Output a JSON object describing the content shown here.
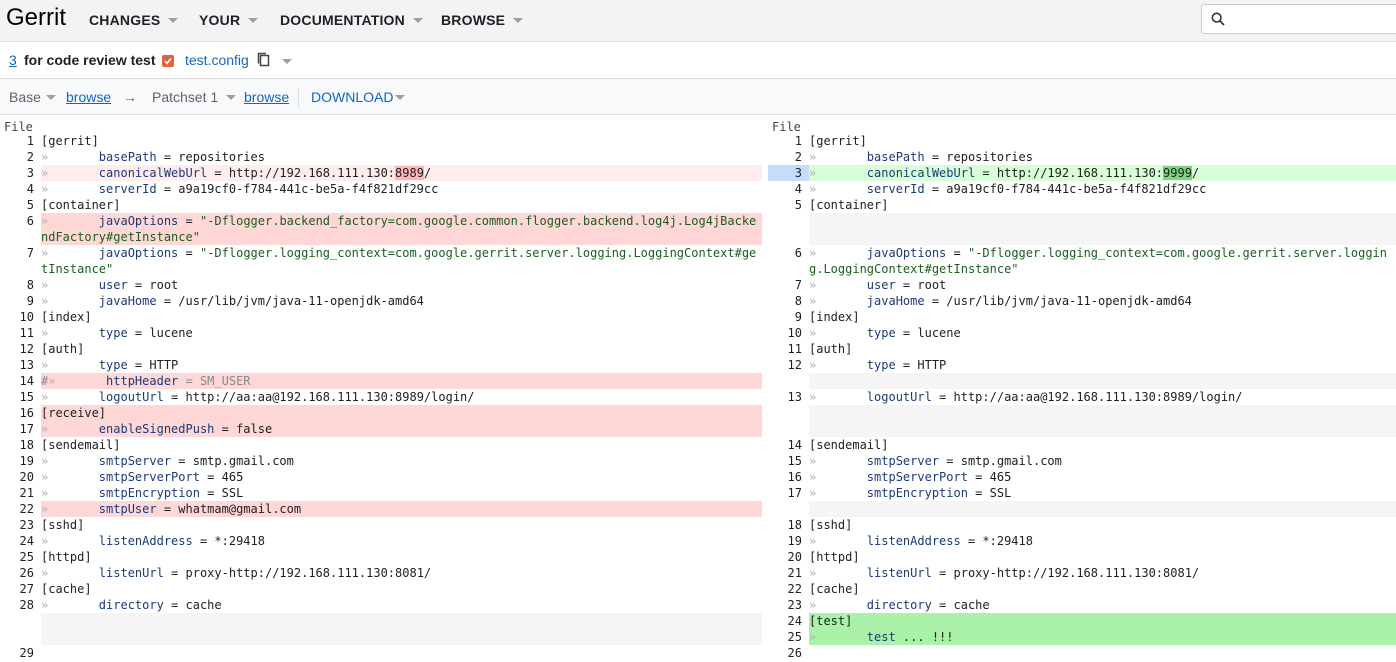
{
  "header": {
    "logo": "Gerrit",
    "nav": [
      {
        "label": "CHANGES"
      },
      {
        "label": "YOUR"
      },
      {
        "label": "DOCUMENTATION"
      },
      {
        "label": "BROWSE"
      }
    ],
    "search_placeholder": ""
  },
  "change": {
    "number": "3",
    "subject": "for code review test",
    "file": "test.config"
  },
  "patchset_bar": {
    "base_label": "Base",
    "browse1": "browse",
    "arrow": "→",
    "patchset_label": "Patchset 1",
    "browse2": "browse",
    "download": "DOWNLOAD"
  },
  "diff": {
    "file_header": "File",
    "left_rows": [
      {
        "ln": "1",
        "type": "same",
        "text": "[gerrit]"
      },
      {
        "ln": "2",
        "type": "same",
        "tab": true,
        "key": "basePath",
        "rest": " = repositories"
      },
      {
        "ln": "3",
        "type": "delb",
        "tab": true,
        "key": "canonicalWebUrl",
        "rest": " = http://192.168.111.130:",
        "hl": "8989",
        "after": "/"
      },
      {
        "ln": "4",
        "type": "same",
        "tab": true,
        "key": "serverId",
        "rest": " = a9a19cf0-f784-441c-be5a-f4f821df29cc"
      },
      {
        "ln": "5",
        "type": "same",
        "text": "[container]"
      },
      {
        "ln": "6",
        "type": "del",
        "tab": true,
        "key": "javaOptions",
        "rest": " = ",
        "str": "\"-Dflogger.backend_factory=com.google.common.flogger.backend.log4j.Log4jBackendFactory#getInstance\""
      },
      {
        "ln": "7",
        "type": "same",
        "tab": true,
        "key": "javaOptions",
        "rest": " = ",
        "str": "\"-Dflogger.logging_context=com.google.gerrit.server.logging.LoggingContext#getInstance\""
      },
      {
        "ln": "8",
        "type": "same",
        "tab": true,
        "key": "user",
        "rest": " = root"
      },
      {
        "ln": "9",
        "type": "same",
        "tab": true,
        "key": "javaHome",
        "rest": " = /usr/lib/jvm/java-11-openjdk-amd64"
      },
      {
        "ln": "10",
        "type": "same",
        "text": "[index]"
      },
      {
        "ln": "11",
        "type": "same",
        "tab": true,
        "key": "type",
        "rest": " = lucene"
      },
      {
        "ln": "12",
        "type": "same",
        "text": "[auth]"
      },
      {
        "ln": "13",
        "type": "same",
        "tab": true,
        "key": "type",
        "rest": " = HTTP"
      },
      {
        "ln": "14",
        "type": "del cmt",
        "hash": true,
        "tab": true,
        "key": "httpHeader",
        "rest": " = SM_USER"
      },
      {
        "ln": "15",
        "type": "same",
        "tab": true,
        "key": "logoutUrl",
        "rest": " = http://aa:aa@192.168.111.130:8989/login/"
      },
      {
        "ln": "16",
        "type": "del",
        "text": "[receive]"
      },
      {
        "ln": "17",
        "type": "del",
        "tab": true,
        "key": "enableSignedPush",
        "rest": " = false"
      },
      {
        "ln": "18",
        "type": "same",
        "text": "[sendemail]"
      },
      {
        "ln": "19",
        "type": "same",
        "tab": true,
        "key": "smtpServer",
        "rest": " = smtp.gmail.com"
      },
      {
        "ln": "20",
        "type": "same",
        "tab": true,
        "key": "smtpServerPort",
        "rest": " = 465"
      },
      {
        "ln": "21",
        "type": "same",
        "tab": true,
        "key": "smtpEncryption",
        "rest": " = SSL"
      },
      {
        "ln": "22",
        "type": "del",
        "tab": true,
        "key": "smtpUser",
        "rest": " = whatmam@gmail.com"
      },
      {
        "ln": "23",
        "type": "same",
        "text": "[sshd]"
      },
      {
        "ln": "24",
        "type": "same",
        "tab": true,
        "key": "listenAddress",
        "rest": " = *:29418"
      },
      {
        "ln": "25",
        "type": "same",
        "text": "[httpd]"
      },
      {
        "ln": "26",
        "type": "same",
        "tab": true,
        "key": "listenUrl",
        "rest": " = proxy-http://192.168.111.130:8081/"
      },
      {
        "ln": "27",
        "type": "same",
        "text": "[cache]"
      },
      {
        "ln": "28",
        "type": "same",
        "tab": true,
        "key": "directory",
        "rest": " = cache"
      },
      {
        "ln": "",
        "type": "empty",
        "text": ""
      },
      {
        "ln": "",
        "type": "empty",
        "text": ""
      },
      {
        "ln": "29",
        "type": "same",
        "text": ""
      }
    ],
    "right_rows": [
      {
        "ln": "1",
        "type": "same",
        "text": "[gerrit]"
      },
      {
        "ln": "2",
        "type": "same",
        "tab": true,
        "key": "basePath",
        "rest": " = repositories"
      },
      {
        "ln": "3",
        "type": "insb",
        "tab": true,
        "key": "canonicalWebUrl",
        "rest": " = http://192.168.111.130:",
        "hl": "9999",
        "after": "/"
      },
      {
        "ln": "4",
        "type": "same",
        "tab": true,
        "key": "serverId",
        "rest": " = a9a19cf0-f784-441c-be5a-f4f821df29cc"
      },
      {
        "ln": "5",
        "type": "same",
        "text": "[container]"
      },
      {
        "ln": "",
        "type": "empty",
        "text": ""
      },
      {
        "ln": "",
        "type": "empty",
        "text": ""
      },
      {
        "ln": "6",
        "type": "same",
        "tab": true,
        "key": "javaOptions",
        "rest": " = ",
        "str": "\"-Dflogger.logging_context=com.google.gerrit.server.logging.LoggingContext#getInstance\""
      },
      {
        "ln": "7",
        "type": "same",
        "tab": true,
        "key": "user",
        "rest": " = root"
      },
      {
        "ln": "8",
        "type": "same",
        "tab": true,
        "key": "javaHome",
        "rest": " = /usr/lib/jvm/java-11-openjdk-amd64"
      },
      {
        "ln": "9",
        "type": "same",
        "text": "[index]"
      },
      {
        "ln": "10",
        "type": "same",
        "tab": true,
        "key": "type",
        "rest": " = lucene"
      },
      {
        "ln": "11",
        "type": "same",
        "text": "[auth]"
      },
      {
        "ln": "12",
        "type": "same",
        "tab": true,
        "key": "type",
        "rest": " = HTTP"
      },
      {
        "ln": "",
        "type": "empty",
        "text": ""
      },
      {
        "ln": "13",
        "type": "same",
        "tab": true,
        "key": "logoutUrl",
        "rest": " = http://aa:aa@192.168.111.130:8989/login/"
      },
      {
        "ln": "",
        "type": "empty",
        "text": ""
      },
      {
        "ln": "",
        "type": "empty",
        "text": ""
      },
      {
        "ln": "14",
        "type": "same",
        "text": "[sendemail]"
      },
      {
        "ln": "15",
        "type": "same",
        "tab": true,
        "key": "smtpServer",
        "rest": " = smtp.gmail.com"
      },
      {
        "ln": "16",
        "type": "same",
        "tab": true,
        "key": "smtpServerPort",
        "rest": " = 465"
      },
      {
        "ln": "17",
        "type": "same",
        "tab": true,
        "key": "smtpEncryption",
        "rest": " = SSL"
      },
      {
        "ln": "",
        "type": "empty",
        "text": ""
      },
      {
        "ln": "18",
        "type": "same",
        "text": "[sshd]"
      },
      {
        "ln": "19",
        "type": "same",
        "tab": true,
        "key": "listenAddress",
        "rest": " = *:29418"
      },
      {
        "ln": "20",
        "type": "same",
        "text": "[httpd]"
      },
      {
        "ln": "21",
        "type": "same",
        "tab": true,
        "key": "listenUrl",
        "rest": " = proxy-http://192.168.111.130:8081/"
      },
      {
        "ln": "22",
        "type": "same",
        "text": "[cache]"
      },
      {
        "ln": "23",
        "type": "same",
        "tab": true,
        "key": "directory",
        "rest": " = cache"
      },
      {
        "ln": "24",
        "type": "ins",
        "text": "[test]"
      },
      {
        "ln": "25",
        "type": "ins",
        "tab": true,
        "key": "test",
        "rest": " ... !!!"
      },
      {
        "ln": "26",
        "type": "same",
        "text": ""
      }
    ]
  }
}
